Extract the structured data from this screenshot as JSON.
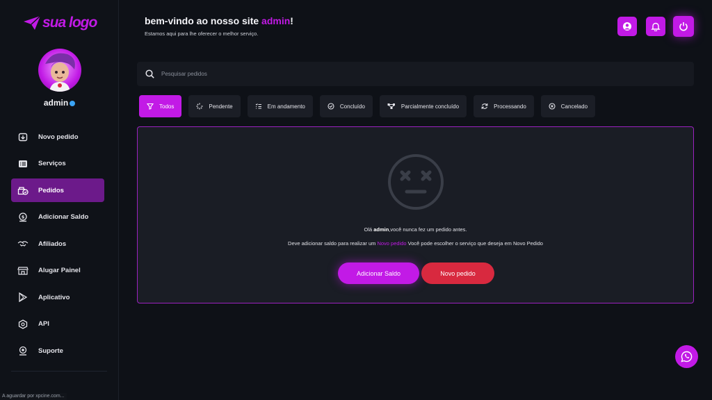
{
  "brand": {
    "logo_text": "sua logo",
    "accent": "#c21ae6"
  },
  "user": {
    "name": "admin"
  },
  "sidebar": {
    "items": [
      {
        "label": "Novo pedido",
        "icon": "new-order-icon",
        "active": false
      },
      {
        "label": "Serviços",
        "icon": "list-icon",
        "active": false
      },
      {
        "label": "Pedidos",
        "icon": "orders-icon",
        "active": true
      },
      {
        "label": "Adicionar Saldo",
        "icon": "wallet-icon",
        "active": false
      },
      {
        "label": "Afiliados",
        "icon": "handshake-icon",
        "active": false
      },
      {
        "label": "Alugar Painel",
        "icon": "store-icon",
        "active": false
      },
      {
        "label": "Aplicativo",
        "icon": "play-store-icon",
        "active": false
      },
      {
        "label": "API",
        "icon": "api-icon",
        "active": false
      },
      {
        "label": "Suporte",
        "icon": "support-icon",
        "active": false
      }
    ]
  },
  "header": {
    "welcome_prefix": "bem-vindo ao nosso site ",
    "welcome_user": "admin",
    "welcome_suffix": "!",
    "subtitle": "Estamos aqui para lhe oferecer o melhor serviço."
  },
  "search": {
    "placeholder": "Pesquisar pedidos"
  },
  "filters": [
    {
      "label": "Todos",
      "icon": "filter-icon",
      "active": true
    },
    {
      "label": "Pendente",
      "icon": "spinner-icon",
      "active": false
    },
    {
      "label": "Em andamento",
      "icon": "list-check-icon",
      "active": false
    },
    {
      "label": "Concluído",
      "icon": "check-circle-icon",
      "active": false
    },
    {
      "label": "Parcialmente concluído",
      "icon": "partial-icon",
      "active": false
    },
    {
      "label": "Processando",
      "icon": "refresh-icon",
      "active": false
    },
    {
      "label": "Cancelado",
      "icon": "cancel-circle-icon",
      "active": false
    }
  ],
  "empty": {
    "msg1_prefix": "Olá ",
    "msg1_user": "admin",
    "msg1_suffix": ",você nunca fez um pedido antes.",
    "msg2_prefix": "Deve adicionar saldo para realizar um ",
    "msg2_link": "Novo pedido",
    "msg2_suffix": " Você pode escolher o serviço que deseja em Novo Pedido",
    "btn_saldo": "Adicionar Saldo",
    "btn_novo": "Novo pedido"
  },
  "status_bar": "A aguardar por xpcine.com..."
}
